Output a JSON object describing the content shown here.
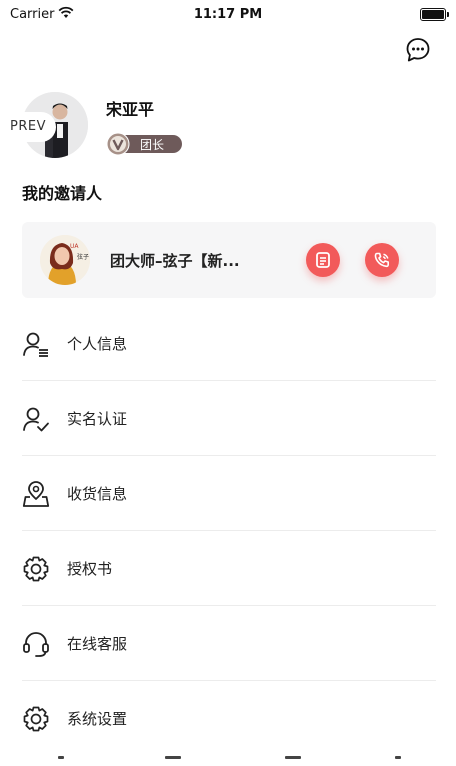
{
  "status_bar": {
    "carrier": "Carrier",
    "time": "11:17 PM",
    "battery_level": 1.0
  },
  "header": {
    "message_icon": "chat-bubble-icon"
  },
  "profile": {
    "name": "宋亚平",
    "role": "团长",
    "prev_label": "PREV"
  },
  "inviter": {
    "title": "我的邀请人",
    "name": "团大师–弦子【新...",
    "avatar_text": "弦子",
    "actions": [
      "document-icon",
      "phone-icon"
    ]
  },
  "menu": {
    "items": [
      {
        "label": "个人信息",
        "icon": "user-list-icon"
      },
      {
        "label": "实名认证",
        "icon": "user-check-icon"
      },
      {
        "label": "收货信息",
        "icon": "location-pin-icon"
      },
      {
        "label": "授权书",
        "icon": "gear-icon"
      },
      {
        "label": "在线客服",
        "icon": "headset-icon"
      },
      {
        "label": "系统设置",
        "icon": "gear-icon"
      }
    ]
  },
  "colors": {
    "accent": "#f25a5a",
    "badge": "#6e5a5a",
    "card_bg": "#f6f6f7"
  }
}
